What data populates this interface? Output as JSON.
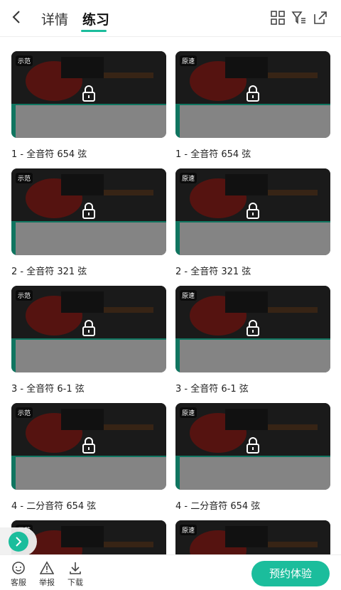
{
  "header": {
    "tabs": [
      "详情",
      "练习"
    ],
    "active_tab": 1,
    "icons": [
      "back-icon",
      "grid-icon",
      "filter-icon",
      "share-icon"
    ]
  },
  "cards": [
    {
      "tag": "示范",
      "title": "1 - 全音符 654 弦"
    },
    {
      "tag": "原速",
      "title": "1 - 全音符 654 弦"
    },
    {
      "tag": "示范",
      "title": "2 - 全音符 321 弦"
    },
    {
      "tag": "原速",
      "title": "2 - 全音符 321 弦"
    },
    {
      "tag": "示范",
      "title": "3 - 全音符 6-1 弦"
    },
    {
      "tag": "原速",
      "title": "3 - 全音符 6-1 弦"
    },
    {
      "tag": "示范",
      "title": "4 - 二分音符 654 弦"
    },
    {
      "tag": "原速",
      "title": "4 - 二分音符 654 弦"
    },
    {
      "tag": "示范",
      "title": ""
    },
    {
      "tag": "原速",
      "title": ""
    }
  ],
  "bottom": {
    "service": "客服",
    "report": "举报",
    "download": "下载",
    "cta": "预约体验"
  },
  "colors": {
    "accent": "#1bbd9c"
  }
}
